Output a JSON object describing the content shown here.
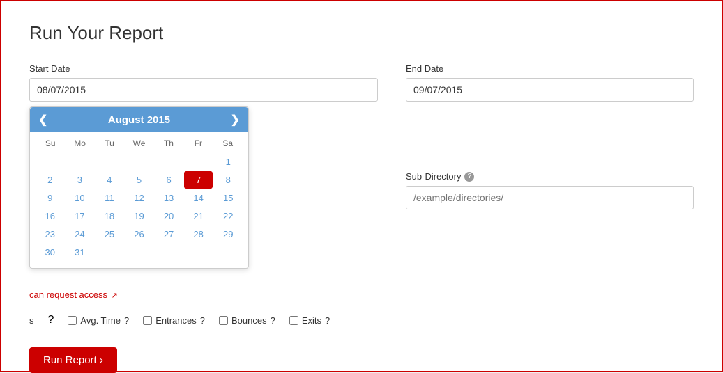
{
  "page": {
    "title": "Run Your Report",
    "border_color": "#cc0000"
  },
  "start_date": {
    "label": "Start Date",
    "value": "08/07/2015"
  },
  "end_date": {
    "label": "End Date",
    "value": "09/07/2015"
  },
  "calendar": {
    "month_year": "August 2015",
    "day_names": [
      "Su",
      "Mo",
      "Tu",
      "We",
      "Th",
      "Fr",
      "Sa"
    ],
    "weeks": [
      [
        "",
        "",
        "",
        "",
        "",
        "",
        "1"
      ],
      [
        "2",
        "3",
        "4",
        "5",
        "6",
        "7",
        "8"
      ],
      [
        "9",
        "10",
        "11",
        "12",
        "13",
        "14",
        "15"
      ],
      [
        "16",
        "17",
        "18",
        "19",
        "20",
        "21",
        "22"
      ],
      [
        "23",
        "24",
        "25",
        "26",
        "27",
        "28",
        "29"
      ],
      [
        "30",
        "31",
        "",
        "",
        "",
        "",
        ""
      ]
    ],
    "selected_day": "7"
  },
  "access_text": "can request access",
  "sub_directory": {
    "label": "Sub-Directory",
    "placeholder": "/example/directories/"
  },
  "checkboxes": [
    {
      "id": "avgtime",
      "label": "Avg. Time",
      "checked": false,
      "has_help": true
    },
    {
      "id": "entrances",
      "label": "Entrances",
      "checked": false,
      "has_help": true
    },
    {
      "id": "bounces",
      "label": "Bounces",
      "checked": false,
      "has_help": true
    },
    {
      "id": "exits",
      "label": "Exits",
      "checked": false,
      "has_help": true
    }
  ],
  "run_button": {
    "label": "Run Report ›"
  }
}
